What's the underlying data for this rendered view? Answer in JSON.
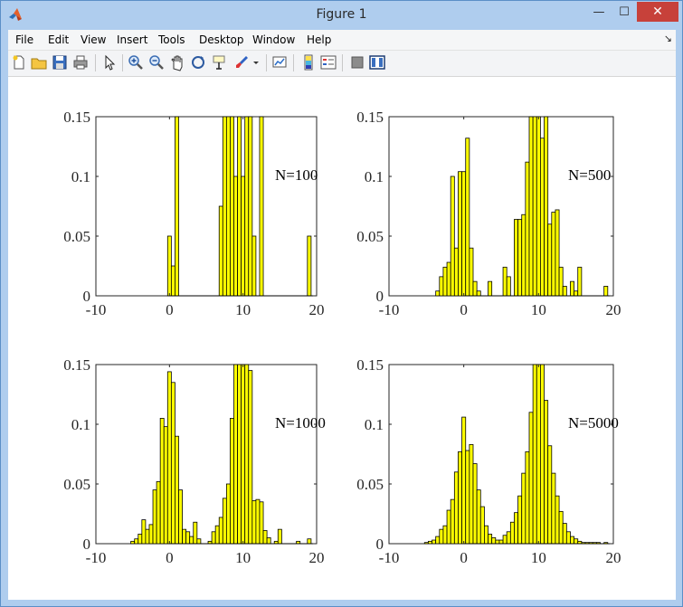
{
  "window": {
    "title": "Figure 1",
    "min_glyph": "—",
    "max_glyph": "☐",
    "close_glyph": "✕"
  },
  "menu": {
    "items": [
      "File",
      "Edit",
      "View",
      "Insert",
      "Tools",
      "Desktop",
      "Window",
      "Help"
    ],
    "overflow_glyph": "↘"
  },
  "toolbar": {
    "icons": [
      "new-figure-icon",
      "open-file-icon",
      "save-icon",
      "print-icon",
      "select-arrow-icon",
      "zoom-in-icon",
      "zoom-out-icon",
      "pan-hand-icon",
      "rotate-3d-icon",
      "data-cursor-icon",
      "brush-icon",
      "link-plot-icon",
      "colorbar-icon",
      "legend-icon",
      "hide-plot-tools-icon",
      "show-plot-tools-icon"
    ]
  },
  "colors": {
    "bar_fill": "#ffff00",
    "bar_edge": "#000000",
    "axis": "#262626",
    "window_frame": "#afcdee",
    "close_button": "#c7413a"
  },
  "chart_data": [
    {
      "type": "bar",
      "annotation": "N=100",
      "xlim": [
        -10,
        20
      ],
      "ylim": [
        0,
        0.15
      ],
      "xticks": [
        "-10",
        "0",
        "10",
        "20"
      ],
      "yticks": [
        "0",
        "0.05",
        "0.1",
        "0.15"
      ],
      "bin_width": 0.5,
      "bars": [
        [
          0,
          0.05
        ],
        [
          0.5,
          0.025
        ],
        [
          1,
          0.15
        ],
        [
          7,
          0.075
        ],
        [
          7.5,
          0.15
        ],
        [
          8,
          0.15
        ],
        [
          8.5,
          0.15
        ],
        [
          9,
          0.1
        ],
        [
          9.5,
          0.15
        ],
        [
          10,
          0.1
        ],
        [
          10.5,
          0.15
        ],
        [
          11,
          0.15
        ],
        [
          11.5,
          0.05
        ],
        [
          12.5,
          0.15
        ],
        [
          19,
          0.05
        ]
      ]
    },
    {
      "type": "bar",
      "annotation": "N=500",
      "xlim": [
        -10,
        20
      ],
      "ylim": [
        0,
        0.15
      ],
      "xticks": [
        "-10",
        "0",
        "10",
        "20"
      ],
      "yticks": [
        "0",
        "0.05",
        "0.1",
        "0.15"
      ],
      "bin_width": 0.5,
      "bars": [
        [
          -3.5,
          0.004
        ],
        [
          -3,
          0.016
        ],
        [
          -2.5,
          0.024
        ],
        [
          -2,
          0.028
        ],
        [
          -1.5,
          0.1
        ],
        [
          -1,
          0.04
        ],
        [
          -0.5,
          0.104
        ],
        [
          0,
          0.104
        ],
        [
          0.5,
          0.132
        ],
        [
          1,
          0.04
        ],
        [
          1.5,
          0.012
        ],
        [
          2,
          0.004
        ],
        [
          3.5,
          0.012
        ],
        [
          5.5,
          0.024
        ],
        [
          6,
          0.016
        ],
        [
          7,
          0.064
        ],
        [
          7.5,
          0.064
        ],
        [
          8,
          0.068
        ],
        [
          8.5,
          0.112
        ],
        [
          9,
          0.15
        ],
        [
          9.5,
          0.15
        ],
        [
          10,
          0.15
        ],
        [
          10.5,
          0.132
        ],
        [
          11,
          0.15
        ],
        [
          11.5,
          0.06
        ],
        [
          12,
          0.07
        ],
        [
          12.5,
          0.072
        ],
        [
          13,
          0.024
        ],
        [
          13.5,
          0.008
        ],
        [
          14.5,
          0.012
        ],
        [
          15,
          0.004
        ],
        [
          15.5,
          0.024
        ],
        [
          19,
          0.008
        ]
      ]
    },
    {
      "type": "bar",
      "annotation": "N=1000",
      "xlim": [
        -10,
        20
      ],
      "ylim": [
        0,
        0.15
      ],
      "xticks": [
        "-10",
        "0",
        "10",
        "20"
      ],
      "yticks": [
        "0",
        "0.05",
        "0.1",
        "0.15"
      ],
      "bin_width": 0.5,
      "bars": [
        [
          -5,
          0.002
        ],
        [
          -4.5,
          0.004
        ],
        [
          -4,
          0.008
        ],
        [
          -3.5,
          0.02
        ],
        [
          -3,
          0.012
        ],
        [
          -2.5,
          0.016
        ],
        [
          -2,
          0.045
        ],
        [
          -1.5,
          0.052
        ],
        [
          -1,
          0.105
        ],
        [
          -0.5,
          0.098
        ],
        [
          0,
          0.144
        ],
        [
          0.5,
          0.135
        ],
        [
          1,
          0.09
        ],
        [
          1.5,
          0.045
        ],
        [
          2,
          0.012
        ],
        [
          2.5,
          0.01
        ],
        [
          3,
          0.006
        ],
        [
          3.5,
          0.018
        ],
        [
          4,
          0.004
        ],
        [
          5.5,
          0.002
        ],
        [
          6,
          0.01
        ],
        [
          6.5,
          0.015
        ],
        [
          7,
          0.022
        ],
        [
          7.5,
          0.038
        ],
        [
          8,
          0.05
        ],
        [
          8.5,
          0.105
        ],
        [
          9,
          0.15
        ],
        [
          9.5,
          0.15
        ],
        [
          10,
          0.15
        ],
        [
          10.5,
          0.15
        ],
        [
          11,
          0.145
        ],
        [
          11.5,
          0.036
        ],
        [
          12,
          0.037
        ],
        [
          12.5,
          0.035
        ],
        [
          13,
          0.011
        ],
        [
          13.5,
          0.005
        ],
        [
          14.5,
          0.002
        ],
        [
          15,
          0.012
        ],
        [
          17.5,
          0.002
        ],
        [
          19,
          0.004
        ]
      ]
    },
    {
      "type": "bar",
      "annotation": "N=5000",
      "xlim": [
        -10,
        20
      ],
      "ylim": [
        0,
        0.15
      ],
      "xticks": [
        "-10",
        "0",
        "10",
        "20"
      ],
      "yticks": [
        "0",
        "0.05",
        "0.1",
        "0.15"
      ],
      "bin_width": 0.5,
      "bars": [
        [
          -5,
          0.001
        ],
        [
          -4.5,
          0.002
        ],
        [
          -4,
          0.003
        ],
        [
          -3.5,
          0.006
        ],
        [
          -3,
          0.012
        ],
        [
          -2.5,
          0.015
        ],
        [
          -2,
          0.028
        ],
        [
          -1.5,
          0.037
        ],
        [
          -1,
          0.06
        ],
        [
          -0.5,
          0.077
        ],
        [
          0,
          0.106
        ],
        [
          0.5,
          0.078
        ],
        [
          1,
          0.083
        ],
        [
          1.5,
          0.067
        ],
        [
          2,
          0.045
        ],
        [
          2.5,
          0.031
        ],
        [
          3,
          0.015
        ],
        [
          3.5,
          0.008
        ],
        [
          4,
          0.005
        ],
        [
          4.5,
          0.003
        ],
        [
          5,
          0.003
        ],
        [
          5.5,
          0.007
        ],
        [
          6,
          0.01
        ],
        [
          6.5,
          0.018
        ],
        [
          7,
          0.026
        ],
        [
          7.5,
          0.04
        ],
        [
          8,
          0.059
        ],
        [
          8.5,
          0.077
        ],
        [
          9,
          0.11
        ],
        [
          9.5,
          0.15
        ],
        [
          10,
          0.15
        ],
        [
          10.5,
          0.15
        ],
        [
          11,
          0.12
        ],
        [
          11.5,
          0.082
        ],
        [
          12,
          0.059
        ],
        [
          12.5,
          0.04
        ],
        [
          13,
          0.027
        ],
        [
          13.5,
          0.017
        ],
        [
          14,
          0.01
        ],
        [
          14.5,
          0.006
        ],
        [
          15,
          0.004
        ],
        [
          15.5,
          0.002
        ],
        [
          16,
          0.001
        ],
        [
          16.5,
          0.001
        ],
        [
          17,
          0.001
        ],
        [
          17.5,
          0.001
        ],
        [
          18,
          0.001
        ],
        [
          19,
          0.001
        ]
      ]
    }
  ]
}
